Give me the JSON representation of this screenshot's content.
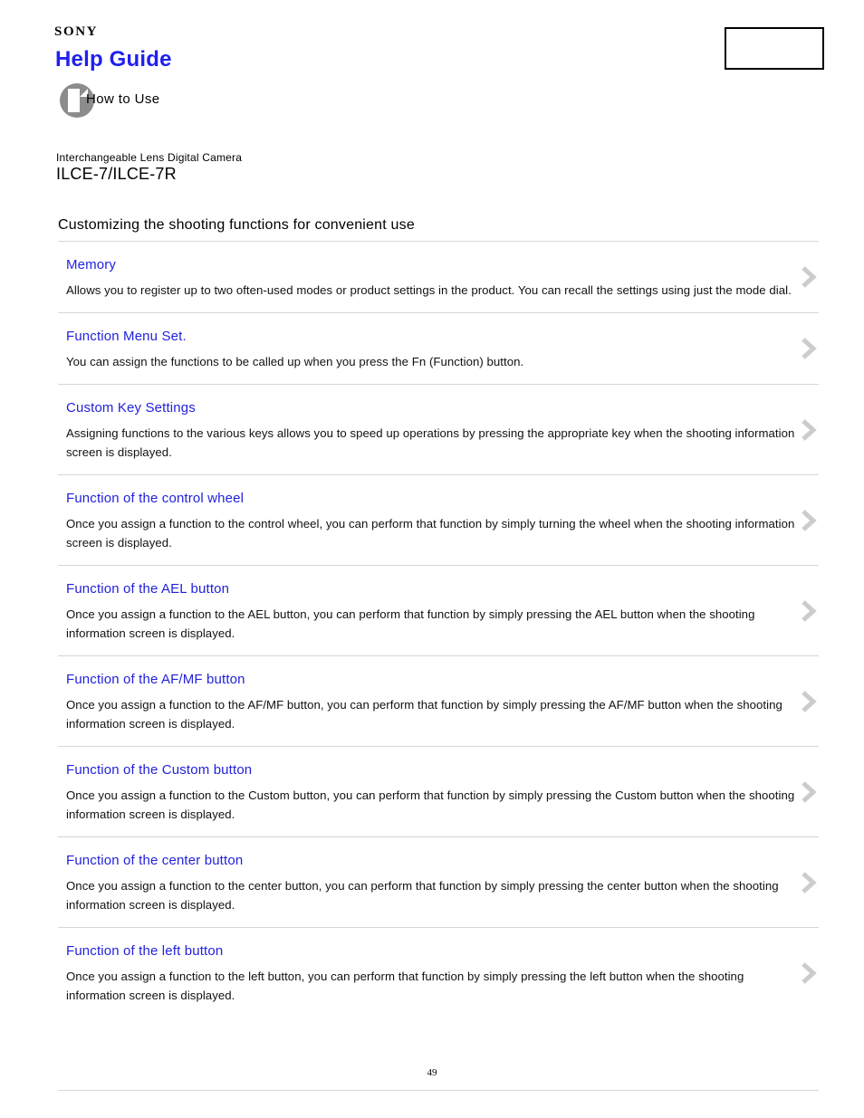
{
  "header": {
    "brand": "SONY",
    "title": "Help Guide",
    "how_to_use_label": "How to Use",
    "how_to_use_icon": "document-page-icon",
    "header_box_label": "",
    "title_color": "#2020ee"
  },
  "product": {
    "category": "Interchangeable Lens Digital Camera",
    "model": "ILCE-7/ILCE-7R"
  },
  "section": {
    "title": "Customizing the shooting functions for convenient use"
  },
  "topics": [
    {
      "link": "Memory",
      "description": "Allows you to register up to two often-used modes or product settings in the product. You can recall the settings using just the mode dial.",
      "chevron": "chevron-right-icon"
    },
    {
      "link": "Function Menu Set.",
      "description": "You can assign the functions to be called up when you press the Fn (Function) button.",
      "chevron": "chevron-right-icon"
    },
    {
      "link": "Custom Key Settings",
      "description": "Assigning functions to the various keys allows you to speed up operations by pressing the appropriate key when the shooting information screen is displayed.",
      "chevron": "chevron-right-icon"
    },
    {
      "link": "Function of the control wheel",
      "description": "Once you assign a function to the control wheel, you can perform that function by simply turning the wheel when the shooting information screen is displayed.",
      "chevron": "chevron-right-icon"
    },
    {
      "link": "Function of the AEL button",
      "description": "Once you assign a function to the AEL button, you can perform that function by simply pressing the AEL button when the shooting information screen is displayed.",
      "chevron": "chevron-right-icon"
    },
    {
      "link": "Function of the AF/MF button",
      "description": "Once you assign a function to the AF/MF button, you can perform that function by simply pressing the AF/MF button when the shooting information screen is displayed.",
      "chevron": "chevron-right-icon"
    },
    {
      "link": "Function of the Custom button",
      "description": "Once you assign a function to the Custom button, you can perform that function by simply pressing the Custom button when the shooting information screen is displayed.",
      "chevron": "chevron-right-icon"
    },
    {
      "link": "Function of the center button",
      "description": "Once you assign a function to the center button, you can perform that function by simply pressing the center button when the shooting information screen is displayed.",
      "chevron": "chevron-right-icon"
    },
    {
      "link": "Function of the left button",
      "description": "Once you assign a function to the left button, you can perform that function by simply pressing the left button when the shooting information screen is displayed.",
      "chevron": "chevron-right-icon"
    }
  ],
  "footer": {
    "page_number": "49"
  },
  "colors": {
    "link": "#2222dd",
    "divider": "#d6d6d6",
    "chevron": "#cccccc",
    "icon_gray": "#8c8c8c"
  }
}
